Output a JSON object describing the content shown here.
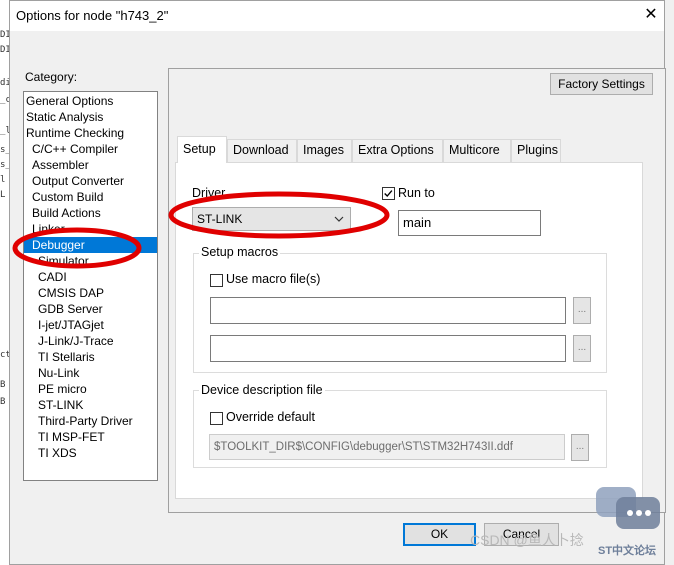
{
  "background_fragments": [
    "DI",
    "DI",
    "di",
    "_c",
    "_l",
    "s_",
    "s_",
    "l",
    "L",
    "ct",
    "B",
    "B"
  ],
  "dialog": {
    "title": "Options for node \"h743_2\"",
    "close_glyph": "✕"
  },
  "category": {
    "label": "Category:",
    "items": [
      "General Options",
      "Static Analysis",
      "Runtime Checking",
      "C/C++ Compiler",
      "Assembler",
      "Output Converter",
      "Custom Build",
      "Build Actions",
      "Linker",
      "Debugger",
      "Simulator",
      "CADI",
      "CMSIS DAP",
      "GDB Server",
      "I-jet/JTAGjet",
      "J-Link/J-Trace",
      "TI Stellaris",
      "Nu-Link",
      "PE micro",
      "ST-LINK",
      "Third-Party Driver",
      "TI MSP-FET",
      "TI XDS"
    ],
    "selected": "Debugger"
  },
  "factory_settings": "Factory Settings",
  "tabs": [
    "Setup",
    "Download",
    "Images",
    "Extra Options",
    "Multicore",
    "Plugins"
  ],
  "active_tab": "Setup",
  "setup": {
    "driver_label": "Driver",
    "driver_value": "ST-LINK",
    "run_to_label": "Run to",
    "run_to_checked": true,
    "run_to_value": "main",
    "setup_macros_title": "Setup macros",
    "use_macro_label": "Use macro file(s)",
    "use_macro_checked": false,
    "macro_file_1": "",
    "macro_file_2": "",
    "browse_label": "...",
    "device_desc_title": "Device description file",
    "override_label": "Override default",
    "override_checked": false,
    "ddf_path": "$TOOLKIT_DIR$\\CONFIG\\debugger\\ST\\STM32H743II.ddf"
  },
  "buttons": {
    "ok": "OK",
    "cancel": "Cancel"
  },
  "watermark": {
    "text": "CSDN @鱼人卜捻",
    "logo_text": "ST中文论坛"
  },
  "colors": {
    "selection": "#0078d7",
    "annotation_red": "#e00000",
    "ok_border": "#0078d7"
  }
}
